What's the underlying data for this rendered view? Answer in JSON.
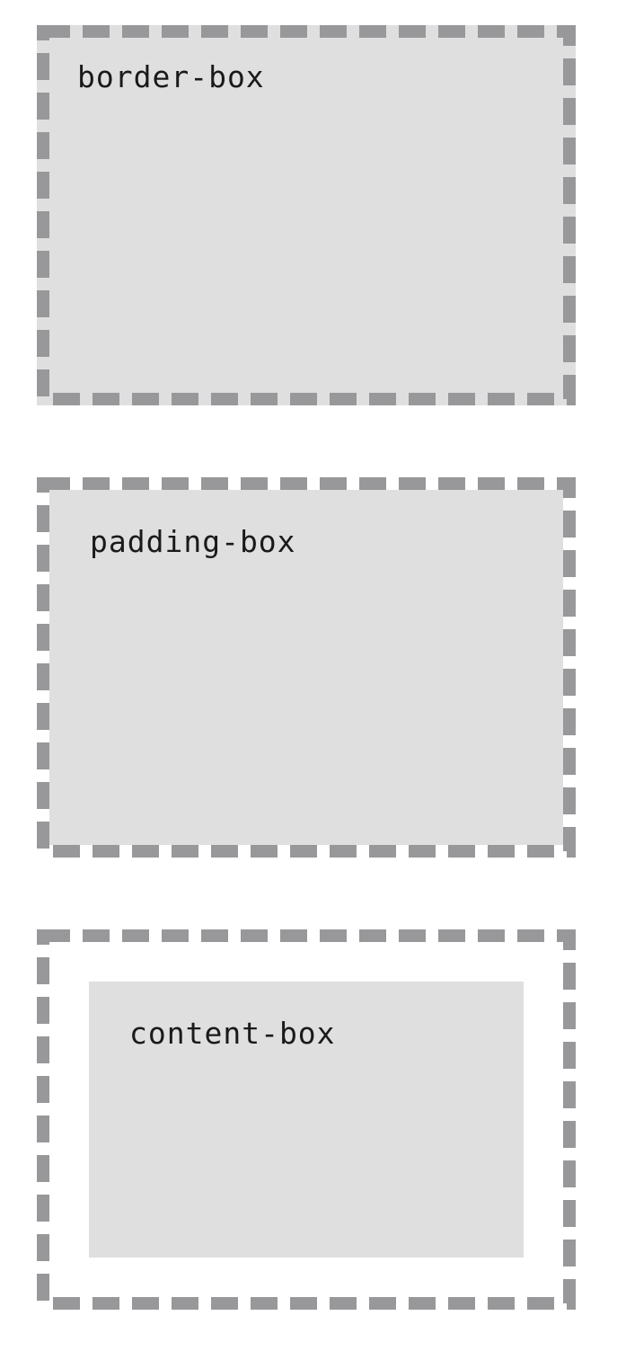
{
  "colors": {
    "border_dash": "#98989b",
    "fill": "#dfdfe0",
    "background": "#ffffff",
    "text": "#1a1a1a"
  },
  "boxes": [
    {
      "label": "border-box",
      "background_clip": "border-box"
    },
    {
      "label": "padding-box",
      "background_clip": "padding-box"
    },
    {
      "label": "content-box",
      "background_clip": "content-box"
    }
  ]
}
